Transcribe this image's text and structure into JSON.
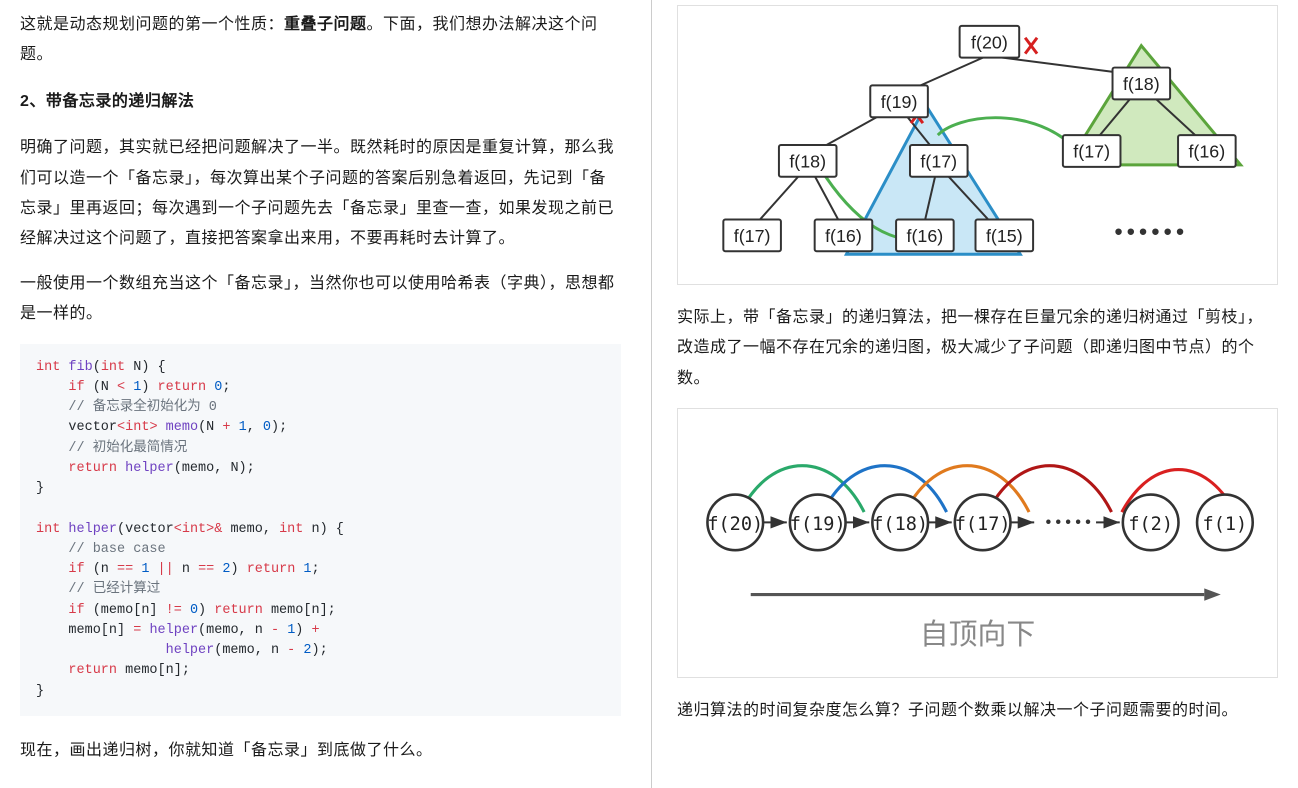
{
  "left": {
    "p1a": "这就是动态规划问题的第一个性质：",
    "p1b": "重叠子问题",
    "p1c": "。下面，我们想办法解决这个问题。",
    "h2": "2、带备忘录的递归解法",
    "p2": "明确了问题，其实就已经把问题解决了一半。既然耗时的原因是重复计算，那么我们可以造一个「备忘录」，每次算出某个子问题的答案后别急着返回，先记到「备忘录」里再返回；每次遇到一个子问题先去「备忘录」里查一查，如果发现之前已经解决过这个问题了，直接把答案拿出来用，不要再耗时去计算了。",
    "p3": "一般使用一个数组充当这个「备忘录」，当然你也可以使用哈希表（字典），思想都是一样的。",
    "code_lines": [
      {
        "raw": "int fib(int N) {",
        "parts": [
          {
            "t": "int ",
            "c": "tok-type"
          },
          {
            "t": "fib",
            "c": "tok-fn"
          },
          {
            "t": "(",
            "c": ""
          },
          {
            "t": "int ",
            "c": "tok-type"
          },
          {
            "t": "N",
            "c": ""
          },
          {
            "t": ") {",
            "c": ""
          }
        ]
      },
      {
        "raw": "    if (N < 1) return 0;",
        "parts": [
          {
            "t": "    ",
            "c": ""
          },
          {
            "t": "if",
            "c": "tok-kw"
          },
          {
            "t": " (N ",
            "c": ""
          },
          {
            "t": "<",
            "c": "tok-op"
          },
          {
            "t": " ",
            "c": ""
          },
          {
            "t": "1",
            "c": "tok-num"
          },
          {
            "t": ") ",
            "c": ""
          },
          {
            "t": "return",
            "c": "tok-kw"
          },
          {
            "t": " ",
            "c": ""
          },
          {
            "t": "0",
            "c": "tok-num"
          },
          {
            "t": ";",
            "c": ""
          }
        ]
      },
      {
        "raw": "    // 备忘录全初始化为 0",
        "parts": [
          {
            "t": "    ",
            "c": ""
          },
          {
            "t": "// 备忘录全初始化为 0",
            "c": "tok-cmt"
          }
        ]
      },
      {
        "raw": "    vector<int> memo(N + 1, 0);",
        "parts": [
          {
            "t": "    vector",
            "c": ""
          },
          {
            "t": "<",
            "c": "tok-op"
          },
          {
            "t": "int",
            "c": "tok-type"
          },
          {
            "t": ">",
            "c": "tok-op"
          },
          {
            "t": " ",
            "c": ""
          },
          {
            "t": "memo",
            "c": "tok-fn"
          },
          {
            "t": "(N ",
            "c": ""
          },
          {
            "t": "+",
            "c": "tok-op"
          },
          {
            "t": " ",
            "c": ""
          },
          {
            "t": "1",
            "c": "tok-num"
          },
          {
            "t": ", ",
            "c": ""
          },
          {
            "t": "0",
            "c": "tok-num"
          },
          {
            "t": ");",
            "c": ""
          }
        ]
      },
      {
        "raw": "    // 初始化最简情况",
        "parts": [
          {
            "t": "    ",
            "c": ""
          },
          {
            "t": "// 初始化最简情况",
            "c": "tok-cmt"
          }
        ]
      },
      {
        "raw": "    return helper(memo, N);",
        "parts": [
          {
            "t": "    ",
            "c": ""
          },
          {
            "t": "return",
            "c": "tok-kw"
          },
          {
            "t": " ",
            "c": ""
          },
          {
            "t": "helper",
            "c": "tok-fn"
          },
          {
            "t": "(memo, N);",
            "c": ""
          }
        ]
      },
      {
        "raw": "}",
        "parts": [
          {
            "t": "}",
            "c": ""
          }
        ]
      },
      {
        "raw": "",
        "parts": [
          {
            "t": " ",
            "c": ""
          }
        ]
      },
      {
        "raw": "int helper(vector<int>& memo, int n) {",
        "parts": [
          {
            "t": "int ",
            "c": "tok-type"
          },
          {
            "t": "helper",
            "c": "tok-fn"
          },
          {
            "t": "(vector",
            "c": ""
          },
          {
            "t": "<",
            "c": "tok-op"
          },
          {
            "t": "int",
            "c": "tok-type"
          },
          {
            "t": ">&",
            "c": "tok-op"
          },
          {
            "t": " memo, ",
            "c": ""
          },
          {
            "t": "int ",
            "c": "tok-type"
          },
          {
            "t": "n",
            "c": ""
          },
          {
            "t": ") {",
            "c": ""
          }
        ]
      },
      {
        "raw": "    // base case",
        "parts": [
          {
            "t": "    ",
            "c": ""
          },
          {
            "t": "// base case",
            "c": "tok-cmt"
          }
        ]
      },
      {
        "raw": "    if (n == 1 || n == 2) return 1;",
        "parts": [
          {
            "t": "    ",
            "c": ""
          },
          {
            "t": "if",
            "c": "tok-kw"
          },
          {
            "t": " (n ",
            "c": ""
          },
          {
            "t": "==",
            "c": "tok-op"
          },
          {
            "t": " ",
            "c": ""
          },
          {
            "t": "1",
            "c": "tok-num"
          },
          {
            "t": " ",
            "c": ""
          },
          {
            "t": "||",
            "c": "tok-op"
          },
          {
            "t": " n ",
            "c": ""
          },
          {
            "t": "==",
            "c": "tok-op"
          },
          {
            "t": " ",
            "c": ""
          },
          {
            "t": "2",
            "c": "tok-num"
          },
          {
            "t": ") ",
            "c": ""
          },
          {
            "t": "return",
            "c": "tok-kw"
          },
          {
            "t": " ",
            "c": ""
          },
          {
            "t": "1",
            "c": "tok-num"
          },
          {
            "t": ";",
            "c": ""
          }
        ]
      },
      {
        "raw": "    // 已经计算过",
        "parts": [
          {
            "t": "    ",
            "c": ""
          },
          {
            "t": "// 已经计算过",
            "c": "tok-cmt"
          }
        ]
      },
      {
        "raw": "    if (memo[n] != 0) return memo[n];",
        "parts": [
          {
            "t": "    ",
            "c": ""
          },
          {
            "t": "if",
            "c": "tok-kw"
          },
          {
            "t": " (memo[n] ",
            "c": ""
          },
          {
            "t": "!=",
            "c": "tok-op"
          },
          {
            "t": " ",
            "c": ""
          },
          {
            "t": "0",
            "c": "tok-num"
          },
          {
            "t": ") ",
            "c": ""
          },
          {
            "t": "return",
            "c": "tok-kw"
          },
          {
            "t": " memo[n];",
            "c": ""
          }
        ]
      },
      {
        "raw": "    memo[n] = helper(memo, n - 1) +",
        "parts": [
          {
            "t": "    memo[n] ",
            "c": ""
          },
          {
            "t": "=",
            "c": "tok-op"
          },
          {
            "t": " ",
            "c": ""
          },
          {
            "t": "helper",
            "c": "tok-fn"
          },
          {
            "t": "(memo, n ",
            "c": ""
          },
          {
            "t": "-",
            "c": "tok-op"
          },
          {
            "t": " ",
            "c": ""
          },
          {
            "t": "1",
            "c": "tok-num"
          },
          {
            "t": ") ",
            "c": ""
          },
          {
            "t": "+",
            "c": "tok-op"
          }
        ]
      },
      {
        "raw": "                helper(memo, n - 2);",
        "parts": [
          {
            "t": "                ",
            "c": ""
          },
          {
            "t": "helper",
            "c": "tok-fn"
          },
          {
            "t": "(memo, n ",
            "c": ""
          },
          {
            "t": "-",
            "c": "tok-op"
          },
          {
            "t": " ",
            "c": ""
          },
          {
            "t": "2",
            "c": "tok-num"
          },
          {
            "t": ");",
            "c": ""
          }
        ]
      },
      {
        "raw": "    return memo[n];",
        "parts": [
          {
            "t": "    ",
            "c": ""
          },
          {
            "t": "return",
            "c": "tok-kw"
          },
          {
            "t": " memo[n];",
            "c": ""
          }
        ]
      },
      {
        "raw": "}",
        "parts": [
          {
            "t": "}",
            "c": ""
          }
        ]
      }
    ],
    "p4": "现在，画出递归树，你就知道「备忘录」到底做了什么。"
  },
  "right": {
    "tree": {
      "nodes": {
        "f20": "f(20)",
        "f19": "f(19)",
        "f18a": "f(18)",
        "f17a": "f(17)",
        "f17b": "f(17)",
        "f16a": "f(16)",
        "f16b": "f(16)",
        "f15": "f(15)",
        "f18b": "f(18)",
        "f17c": "f(17)",
        "f16c": "f(16)"
      },
      "dots": "••••••"
    },
    "p1": "实际上，带「备忘录」的递归算法，把一棵存在巨量冗余的递归树通过「剪枝」，改造成了一幅不存在冗余的递归图，极大减少了子问题（即递归图中节点）的个数。",
    "chain": {
      "labels": [
        "f(20)",
        "f(19)",
        "f(18)",
        "f(17)",
        "f(2)",
        "f(1)"
      ],
      "dots": "•••••",
      "caption": "自顶向下"
    },
    "p2": "递归算法的时间复杂度怎么算？子问题个数乘以解决一个子问题需要的时间。"
  }
}
